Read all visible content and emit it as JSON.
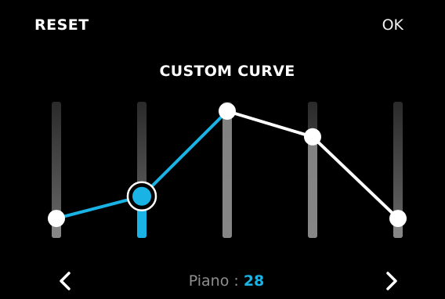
{
  "header": {
    "reset_label": "RESET",
    "ok_label": "OK",
    "title": "CUSTOM CURVE"
  },
  "curve": {
    "point_levels": [
      0.08,
      0.27,
      1.0,
      0.78,
      0.08
    ],
    "selected_point": 1,
    "colors": {
      "accent": "#19b3e6",
      "line": "#ffffff",
      "track": "#4a4a4a",
      "background": "#000000"
    }
  },
  "footer": {
    "prev_icon": "chevron-left-icon",
    "next_icon": "chevron-right-icon",
    "status_label": "Piano : ",
    "status_value": "28"
  }
}
